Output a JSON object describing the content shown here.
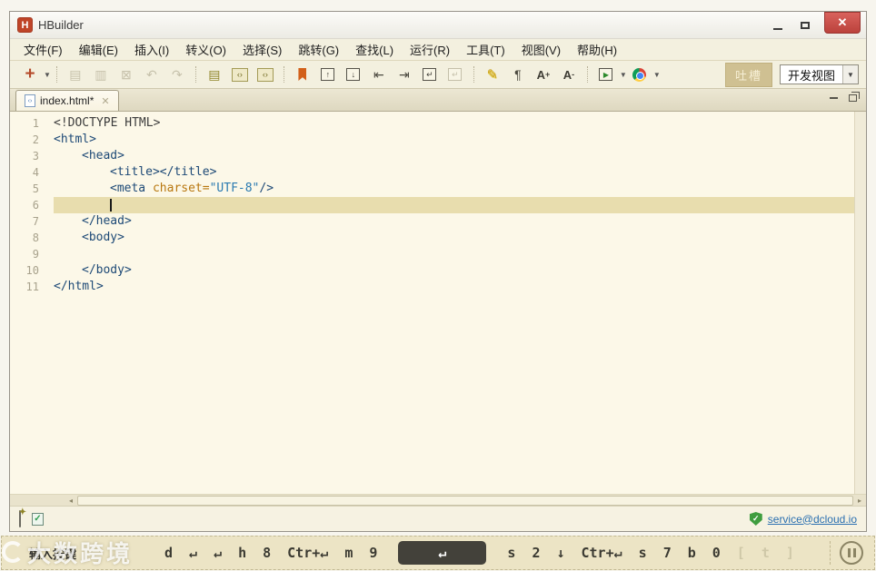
{
  "window": {
    "title": "HBuilder",
    "logo_letter": "H",
    "controls": {
      "minimize": "minimize",
      "maximize": "maximize",
      "close": "✕"
    }
  },
  "menu": {
    "items": [
      "文件(F)",
      "编辑(E)",
      "插入(I)",
      "转义(O)",
      "选择(S)",
      "跳转(G)",
      "查找(L)",
      "运行(R)",
      "工具(T)",
      "视图(V)",
      "帮助(H)"
    ]
  },
  "toolbar": {
    "items": [
      {
        "name": "new-file",
        "glyph": "+",
        "cls": "icon-new",
        "dropdown": true
      },
      {
        "sep": true
      },
      {
        "name": "save",
        "glyph": "▤",
        "disabled": true
      },
      {
        "name": "save-all",
        "glyph": "▥",
        "disabled": true
      },
      {
        "name": "close-all",
        "glyph": "⊠",
        "disabled": true
      },
      {
        "name": "undo",
        "glyph": "↶",
        "disabled": true
      },
      {
        "name": "redo",
        "glyph": "↷",
        "disabled": true
      },
      {
        "sep": true
      },
      {
        "name": "outline",
        "glyph": "▤",
        "cls": "icon-olive"
      },
      {
        "name": "code-assist",
        "glyph": "‹›",
        "box": "olive-box"
      },
      {
        "name": "code-block",
        "glyph": "‹›",
        "box": "olive-box"
      },
      {
        "sep": true
      },
      {
        "name": "bookmark",
        "shape": "ribbon"
      },
      {
        "name": "doc-up",
        "glyph": "↑",
        "box": "mini-box"
      },
      {
        "name": "doc-down",
        "glyph": "↓",
        "box": "mini-box"
      },
      {
        "name": "jump-line-start",
        "glyph": "⇤"
      },
      {
        "name": "jump-line-end",
        "glyph": "⇥"
      },
      {
        "name": "soft-wrap",
        "glyph": "↵",
        "box": "mini-box"
      },
      {
        "name": "soft-wrap-off",
        "glyph": "↵",
        "box": "mini-box dis",
        "disabled": true
      },
      {
        "sep": true
      },
      {
        "name": "highlighter",
        "glyph": "✎",
        "cls": "pen"
      },
      {
        "name": "show-whitespace",
        "glyph": "¶"
      },
      {
        "name": "font-increase",
        "glyph": "A",
        "sup": "+",
        "cls": "fontbtn"
      },
      {
        "name": "font-decrease",
        "glyph": "A",
        "sup": "-",
        "cls": "fontbtn"
      },
      {
        "sep": true
      },
      {
        "name": "run-in-browser",
        "glyph": "▶",
        "box": "runbox",
        "dropdown": true
      },
      {
        "name": "run-in-chrome",
        "shape": "chrome",
        "dropdown": true
      }
    ],
    "tucao_label": "吐槽",
    "view_select_value": "开发视图"
  },
  "tabbar": {
    "active_tab": "index.html",
    "modified_mark": "*",
    "close_glyph": "✕"
  },
  "editor": {
    "lines": [
      {
        "n": "1",
        "indent": 0,
        "tokens": [
          {
            "t": "plain",
            "v": "<!DOCTYPE HTML>"
          }
        ]
      },
      {
        "n": "2",
        "indent": 0,
        "tokens": [
          {
            "t": "tag",
            "v": "<html>"
          }
        ]
      },
      {
        "n": "3",
        "indent": 1,
        "tokens": [
          {
            "t": "tag",
            "v": "<head>"
          }
        ]
      },
      {
        "n": "4",
        "indent": 2,
        "tokens": [
          {
            "t": "tag",
            "v": "<title></title>"
          }
        ]
      },
      {
        "n": "5",
        "indent": 2,
        "tokens": [
          {
            "t": "tag",
            "v": "<meta "
          },
          {
            "t": "attr",
            "v": "charset="
          },
          {
            "t": "value",
            "v": "\"UTF-8\""
          },
          {
            "t": "tag",
            "v": "/>"
          }
        ]
      },
      {
        "n": "6",
        "indent": 2,
        "current": true,
        "cursor": true,
        "tokens": []
      },
      {
        "n": "7",
        "indent": 1,
        "tokens": [
          {
            "t": "tag",
            "v": "</head>"
          }
        ]
      },
      {
        "n": "8",
        "indent": 1,
        "tokens": [
          {
            "t": "tag",
            "v": "<body>"
          }
        ]
      },
      {
        "n": "9",
        "indent": 0,
        "tokens": []
      },
      {
        "n": "10",
        "indent": 1,
        "tokens": [
          {
            "t": "tag",
            "v": "</body>"
          }
        ]
      },
      {
        "n": "11",
        "indent": 0,
        "tokens": [
          {
            "t": "tag",
            "v": "</html>"
          }
        ]
      }
    ]
  },
  "statusbar": {
    "email_link": "service@dcloud.io",
    "shield_check": "✓"
  },
  "keycast": {
    "label": "输入按键",
    "keys": [
      {
        "v": "d"
      },
      {
        "v": "↵"
      },
      {
        "v": "↵"
      },
      {
        "v": "h"
      },
      {
        "v": "8"
      },
      {
        "v": "Ctr+↵"
      },
      {
        "v": "m"
      },
      {
        "v": "9"
      },
      {
        "v": "↵",
        "style": "pressed"
      },
      {
        "v": "s"
      },
      {
        "v": "2"
      },
      {
        "v": "↓"
      },
      {
        "v": "Ctr+↵"
      },
      {
        "v": "s"
      },
      {
        "v": "7"
      },
      {
        "v": "b"
      },
      {
        "v": "0"
      },
      {
        "v": "[",
        "style": "faint"
      },
      {
        "v": "t",
        "style": "faint"
      },
      {
        "v": "]",
        "style": "faint"
      }
    ]
  },
  "watermark": {
    "text": "大数跨境"
  },
  "colors": {
    "accent_close": "#c0443c",
    "logo": "#bf4428",
    "current_line": "#e8ddae",
    "tag": "#1d4976",
    "attr": "#b8770f",
    "value": "#2a7ab0",
    "link": "#2a6fb0"
  }
}
